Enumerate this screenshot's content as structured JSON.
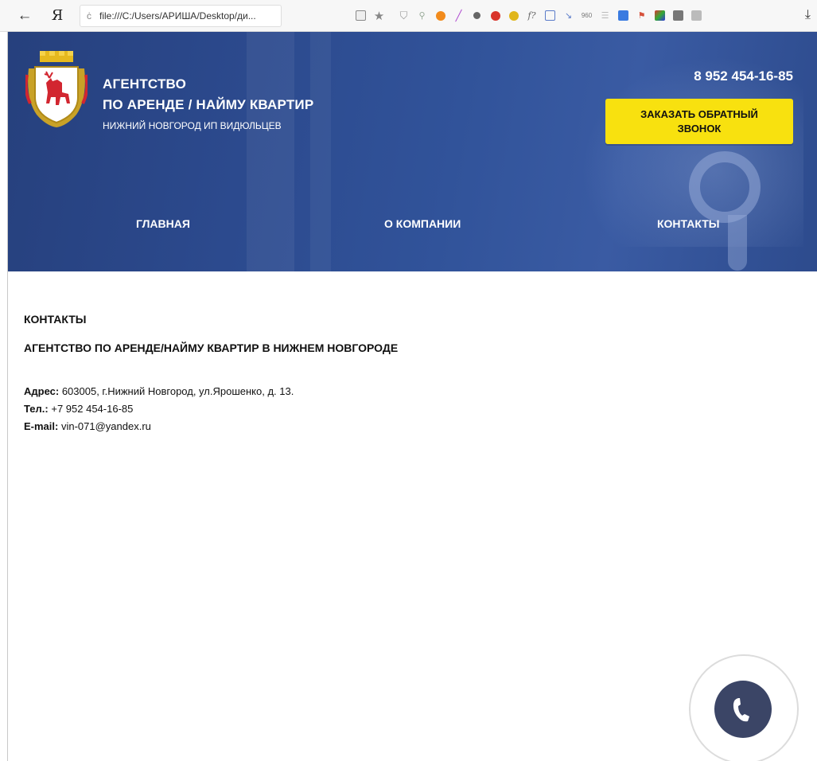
{
  "browser": {
    "back_glyph": "←",
    "yandex_logo": "Я",
    "reload_glyph": "ċ",
    "address": "file:///C:/Users/АРИША/Desktop/ди...",
    "download_glyph": "⤓",
    "toolbar_icons": [
      "page-icon",
      "star-icon",
      "shield-icon",
      "magnifier-icon",
      "orange-extension-icon",
      "feather-icon",
      "bulb-icon",
      "adblock-icon",
      "green-extension-icon",
      "formula-icon",
      "frame-icon",
      "link-icon",
      "960-icon",
      "lines-icon",
      "blue-extension-icon",
      "pin-icon",
      "colors-icon",
      "camera-icon",
      "gray-extension-icon"
    ]
  },
  "header": {
    "brand_line1": "АГЕНТСТВО",
    "brand_line2": "ПО АРЕНДЕ / НАЙМУ КВАРТИР",
    "brand_sub": "НИЖНИЙ НОВГОРОД ИП ВИДЮЛЬЦЕВ",
    "phone": "8 952 454-16-85",
    "callback_button": "ЗАКАЗАТЬ ОБРАТНЫЙ ЗВОНОК",
    "colors": {
      "header_bg": "#2c4a8e",
      "button_bg": "#f8e10f"
    }
  },
  "nav": {
    "home": "ГЛАВНАЯ",
    "about": "О КОМПАНИИ",
    "contacts": "КОНТАКТЫ"
  },
  "content": {
    "title": "КОНТАКТЫ",
    "subtitle": "АГЕНТСТВО ПО АРЕНДЕ/НАЙМУ КВАРТИР В НИЖНЕМ НОВГОРОДЕ",
    "address_label": "Адрес:",
    "address_value": "603005, г.Нижний Новгород, ул.Ярошенко, д. 13.",
    "phone_label": "Тел.:",
    "phone_value": "+7 952 454-16-85",
    "email_label": "E-mail:",
    "email_value": "vin-071@yandex.ru"
  },
  "widget": {
    "icon": "phone-icon",
    "color": "#3b4566"
  }
}
